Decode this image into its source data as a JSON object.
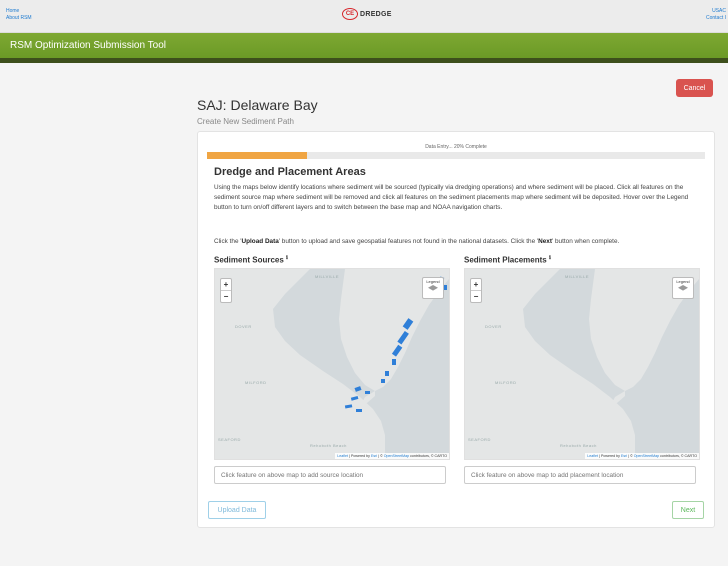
{
  "topbar": {
    "links_left": [
      "Home",
      "About RSM"
    ],
    "links_right": [
      "USAC",
      "Contact I"
    ],
    "logo_mark": "CE",
    "logo_text": "DREDGE"
  },
  "banner": {
    "title": "RSM Optimization Submission Tool"
  },
  "cancel_label": "Cancel",
  "page": {
    "title": "SAJ: Delaware Bay",
    "subtitle": "Create New Sediment Path"
  },
  "progress": {
    "label": "Data Entry... 20% Complete",
    "fraction": 0.2,
    "color": "#f0a543"
  },
  "section": {
    "title": "Dredge and Placement Areas",
    "description": "Using the maps below identify locations where sediment will be sourced (typically via dredging operations) and where sediment will be placed. Click all features on the sediment source map where sediment will be removed and click all features on the sediment placements map where sediment will be deposited. Hover over the Legend button to turn on/off different layers and to switch between the base map and NOAA navigation charts.",
    "instruction_pre": "Click the '",
    "instruction_upload": "Upload Data",
    "instruction_mid": "' button to upload and save geospatial features not found in the national datasets. Click the '",
    "instruction_next": "Next",
    "instruction_post": "' button when complete."
  },
  "maps": {
    "sources": {
      "title": "Sediment Sources",
      "info": "ℹ",
      "zoom_in": "+",
      "zoom_out": "−",
      "legend": "Legend",
      "place_labels": [
        "MILLVILLE",
        "DOVER",
        "MILFORD",
        "SEAFORD",
        "Rehoboth Beach"
      ],
      "attribution": {
        "leaflet": "Leaflet",
        "powered": " | Powered by ",
        "esri": "Esri",
        "mid": " | © ",
        "osm": "OpenStreetMap",
        "end": " contributors, © CARTO"
      },
      "input_placeholder": "Click feature on above map to add source location"
    },
    "placements": {
      "title": "Sediment Placements",
      "info": "ℹ",
      "zoom_in": "+",
      "zoom_out": "−",
      "legend": "Legend",
      "place_labels": [
        "MILLVILLE",
        "DOVER",
        "MILFORD",
        "SEAFORD",
        "Rehoboth Beach"
      ],
      "attribution": {
        "leaflet": "Leaflet",
        "powered": " | Powered by ",
        "esri": "Esri",
        "mid": " | © ",
        "osm": "OpenStreetMap",
        "end": " contributors, © CARTO"
      },
      "input_placeholder": "Click feature on above map to add placement location"
    },
    "feature_color": "#2f7fd8"
  },
  "buttons": {
    "upload": "Upload Data",
    "next": "Next"
  }
}
